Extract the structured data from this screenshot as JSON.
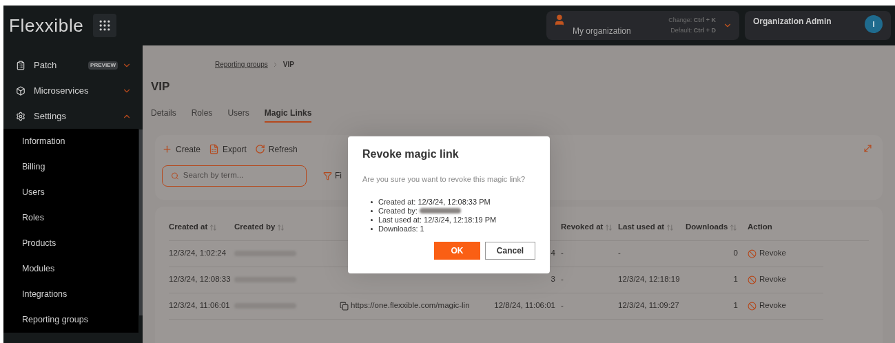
{
  "header": {
    "logo": "Flexxible",
    "organization": {
      "name": "My organization",
      "hints": [
        "Change: **Ctrl + K**",
        "Default: **Ctrl + D**"
      ]
    },
    "user": {
      "name": "Organization Admin",
      "initial": "I"
    }
  },
  "sidebar": {
    "items": [
      {
        "label": "Patch",
        "badge": "PREVIEW",
        "expanded": false
      },
      {
        "label": "Microservices",
        "expanded": false
      },
      {
        "label": "Settings",
        "expanded": true,
        "children": [
          {
            "label": "Information"
          },
          {
            "label": "Billing"
          },
          {
            "label": "Users"
          },
          {
            "label": "Roles"
          },
          {
            "label": "Products"
          },
          {
            "label": "Modules"
          },
          {
            "label": "Integrations"
          },
          {
            "label": "Reporting groups"
          }
        ]
      }
    ]
  },
  "breadcrumb": [
    "Reporting groups",
    "VIP"
  ],
  "title": "VIP",
  "tabs": [
    {
      "label": "Details",
      "selected": false
    },
    {
      "label": "Roles",
      "selected": false
    },
    {
      "label": "Users",
      "selected": false
    },
    {
      "label": "Magic Links",
      "selected": true
    }
  ],
  "toolbar": {
    "actions": [
      "Create",
      "Export",
      "Refresh"
    ],
    "search": {
      "placeholder": "Search by term..."
    },
    "filter": "Fi"
  },
  "table": {
    "columns": [
      {
        "label": "Created at",
        "sortable": true
      },
      {
        "label": "Created by",
        "sortable": true
      },
      {
        "label": "Revoked at",
        "sortable": true
      },
      {
        "label": "Last used at",
        "sortable": true
      },
      {
        "label": "Downloads",
        "sortable": true
      },
      {
        "label": "Action",
        "sortable": false
      }
    ],
    "rows": [
      {
        "created_at": "12/3/24, 1:02:24",
        "column_4": "4",
        "revoked_at": "-",
        "last_used_at": "-",
        "downloads": "0",
        "action": "Revoke"
      },
      {
        "created_at": "12/3/24, 12:08:33",
        "column_4": "3",
        "revoked_at": "-",
        "last_used_at": "12/3/24, 12:18:19",
        "downloads": "1",
        "action": "Revoke"
      },
      {
        "created_at": "12/3/24, 11:06:01",
        "link": "https://one.flexxible.com/magic-lin",
        "column_4": "12/8/24, 11:06:01",
        "revoked_at": "-",
        "last_used_at": "12/3/24, 11:09:27",
        "downloads": "1",
        "action": "Revoke"
      }
    ]
  },
  "dialog": {
    "title": "Revoke magic link",
    "message": "Are you sure you want to revoke this magic link?",
    "details": [
      {
        "text": "Created at: 12/3/24, 12:08:33 PM",
        "redacted": false
      },
      {
        "text": "Created by:",
        "redacted": true
      },
      {
        "text": "Last used at: 12/3/24, 12:18:19 PM",
        "redacted": false
      },
      {
        "text": "Downloads: 1",
        "redacted": false
      }
    ],
    "buttons": [
      {
        "label": "OK",
        "kind": "primary"
      },
      {
        "label": "Cancel",
        "kind": "secondary"
      }
    ]
  }
}
